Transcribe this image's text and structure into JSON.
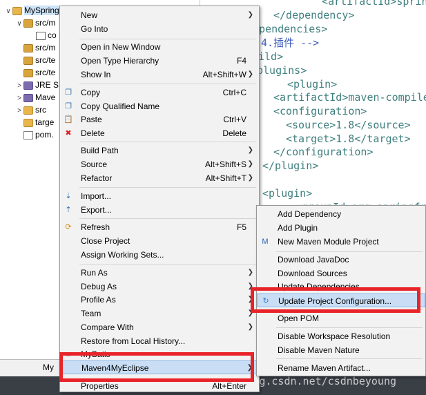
{
  "explorer": {
    "rows": [
      {
        "arrow": "∨",
        "icon": "folder",
        "label": "MySpring"
      },
      {
        "arrow": "∨",
        "icon": "pkg",
        "label": "src/m"
      },
      {
        "arrow": "",
        "icon": "class",
        "label": "co"
      },
      {
        "arrow": "",
        "icon": "pkg",
        "label": "src/m"
      },
      {
        "arrow": "",
        "icon": "pkg",
        "label": "src/te"
      },
      {
        "arrow": "",
        "icon": "pkg",
        "label": "src/te"
      },
      {
        "arrow": ">",
        "icon": "jar",
        "label": "JRE S"
      },
      {
        "arrow": ">",
        "icon": "jar",
        "label": "Mave"
      },
      {
        "arrow": ">",
        "icon": "folder",
        "label": "src"
      },
      {
        "arrow": "",
        "icon": "folder",
        "label": "targe"
      },
      {
        "arrow": "",
        "icon": "xml",
        "label": "pom."
      }
    ]
  },
  "editor": {
    "lines": [
      {
        "text": "<artifactId>sprin",
        "kind": "tag"
      },
      {
        "text": "</dependency>",
        "kind": "tag"
      },
      {
        "text": "ependencies>",
        "kind": "tag"
      },
      {
        "text": "4.插件 -->",
        "kind": "cmt"
      },
      {
        "text": "ild>",
        "kind": "tag"
      },
      {
        "text": "plugins>",
        "kind": "tag"
      },
      {
        "text": "<plugin>",
        "kind": "tag"
      },
      {
        "text": "<artifactId>maven-compile",
        "kind": "mixed"
      },
      {
        "text": "<configuration>",
        "kind": "tag"
      },
      {
        "text": "<source>1.8</source>",
        "kind": "mixed"
      },
      {
        "text": "<target>1.8</target>",
        "kind": "mixed"
      },
      {
        "text": "</configuration>",
        "kind": "tag"
      },
      {
        "text": "</plugin>",
        "kind": "tag"
      },
      {
        "text": "<plugin>",
        "kind": "tag"
      },
      {
        "text": "<groupId>org.springfr",
        "kind": "tag"
      }
    ]
  },
  "bottombar": {
    "tab_label": "My"
  },
  "watermark": "https://blog.csdn.net/csdnbeyoung",
  "main_menu": {
    "items": [
      {
        "name": "menu-new",
        "label": "New",
        "key": "",
        "sub": true,
        "icon": ""
      },
      {
        "name": "menu-go-into",
        "label": "Go Into",
        "key": "",
        "sub": false,
        "icon": ""
      },
      {
        "sep": true
      },
      {
        "name": "menu-open-new-window",
        "label": "Open in New Window",
        "key": "",
        "sub": false,
        "icon": ""
      },
      {
        "name": "menu-open-type-hierarchy",
        "label": "Open Type Hierarchy",
        "key": "F4",
        "sub": false,
        "icon": ""
      },
      {
        "name": "menu-show-in",
        "label": "Show In",
        "key": "Alt+Shift+W",
        "sub": true,
        "icon": ""
      },
      {
        "sep": true
      },
      {
        "name": "menu-copy",
        "label": "Copy",
        "key": "Ctrl+C",
        "sub": false,
        "icon": "copy"
      },
      {
        "name": "menu-copy-qualified-name",
        "label": "Copy Qualified Name",
        "key": "",
        "sub": false,
        "icon": "copy"
      },
      {
        "name": "menu-paste",
        "label": "Paste",
        "key": "Ctrl+V",
        "sub": false,
        "icon": "paste"
      },
      {
        "name": "menu-delete",
        "label": "Delete",
        "key": "Delete",
        "sub": false,
        "icon": "delete"
      },
      {
        "sep": true
      },
      {
        "name": "menu-build-path",
        "label": "Build Path",
        "key": "",
        "sub": true,
        "icon": ""
      },
      {
        "name": "menu-source",
        "label": "Source",
        "key": "Alt+Shift+S",
        "sub": true,
        "icon": ""
      },
      {
        "name": "menu-refactor",
        "label": "Refactor",
        "key": "Alt+Shift+T",
        "sub": true,
        "icon": ""
      },
      {
        "sep": true
      },
      {
        "name": "menu-import",
        "label": "Import...",
        "key": "",
        "sub": false,
        "icon": "import"
      },
      {
        "name": "menu-export",
        "label": "Export...",
        "key": "",
        "sub": false,
        "icon": "export"
      },
      {
        "sep": true
      },
      {
        "name": "menu-refresh",
        "label": "Refresh",
        "key": "F5",
        "sub": false,
        "icon": "refresh"
      },
      {
        "name": "menu-close-project",
        "label": "Close Project",
        "key": "",
        "sub": false,
        "icon": ""
      },
      {
        "name": "menu-assign-working-sets",
        "label": "Assign Working Sets...",
        "key": "",
        "sub": false,
        "icon": ""
      },
      {
        "sep": true
      },
      {
        "name": "menu-run-as",
        "label": "Run As",
        "key": "",
        "sub": true,
        "icon": ""
      },
      {
        "name": "menu-debug-as",
        "label": "Debug As",
        "key": "",
        "sub": true,
        "icon": ""
      },
      {
        "name": "menu-profile-as",
        "label": "Profile As",
        "key": "",
        "sub": true,
        "icon": ""
      },
      {
        "name": "menu-team",
        "label": "Team",
        "key": "",
        "sub": true,
        "icon": ""
      },
      {
        "name": "menu-compare-with",
        "label": "Compare With",
        "key": "",
        "sub": true,
        "icon": ""
      },
      {
        "name": "menu-restore-local-history",
        "label": "Restore from Local History...",
        "key": "",
        "sub": false,
        "icon": ""
      },
      {
        "name": "menu-mybatis",
        "label": "MyBatis",
        "key": "",
        "sub": false,
        "icon": "mybatis"
      },
      {
        "name": "menu-maven4myeclipse",
        "label": "Maven4MyEclipse",
        "key": "",
        "sub": true,
        "icon": "",
        "hover": true
      },
      {
        "name": "menu-properties",
        "label": "Properties",
        "key": "Alt+Enter",
        "sub": false,
        "icon": ""
      }
    ]
  },
  "sub_menu": {
    "items": [
      {
        "name": "sub-add-dependency",
        "label": "Add Dependency",
        "icon": ""
      },
      {
        "name": "sub-add-plugin",
        "label": "Add Plugin",
        "icon": ""
      },
      {
        "name": "sub-new-maven-module",
        "label": "New Maven Module Project",
        "icon": "maven"
      },
      {
        "sep": true
      },
      {
        "name": "sub-download-javadoc",
        "label": "Download JavaDoc",
        "icon": ""
      },
      {
        "name": "sub-download-sources",
        "label": "Download Sources",
        "icon": ""
      },
      {
        "name": "sub-update-dependencies",
        "label": "Update Dependencies",
        "icon": ""
      },
      {
        "name": "sub-update-project-configuration",
        "label": "Update Project Configuration...",
        "icon": "update",
        "hover": true
      },
      {
        "sep": true
      },
      {
        "name": "sub-open-pom",
        "label": "Open POM",
        "icon": ""
      },
      {
        "sep": true
      },
      {
        "name": "sub-disable-workspace-resolution",
        "label": "Disable Workspace Resolution",
        "icon": ""
      },
      {
        "name": "sub-disable-maven-nature",
        "label": "Disable Maven Nature",
        "icon": ""
      },
      {
        "sep": true
      },
      {
        "name": "sub-rename-maven-artifact",
        "label": "Rename Maven Artifact...",
        "icon": ""
      }
    ]
  },
  "colors": {
    "highlight_red": "#e8242a",
    "hover_blue": "#c9def5",
    "menu_bg": "#f2f2f2"
  }
}
